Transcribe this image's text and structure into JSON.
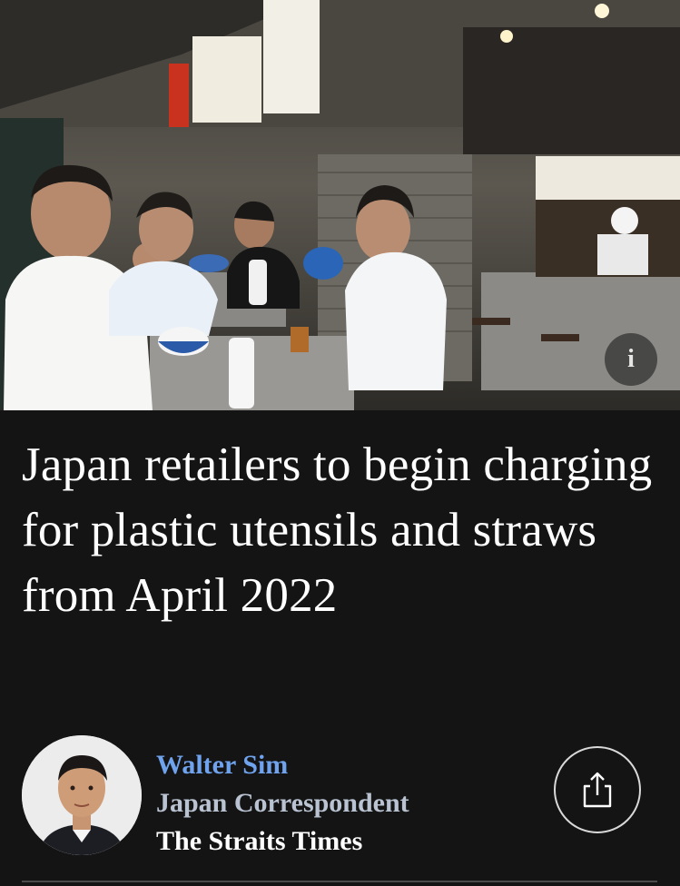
{
  "article": {
    "headline": "Japan retailers to begin charging for plastic utensils and straws from April 2022",
    "image_alt": "Diners eating standing at a noodle stall",
    "info_label": "i"
  },
  "author": {
    "name": "Walter Sim",
    "title": "Japan Correspondent",
    "publication": "The Straits Times"
  },
  "icons": {
    "info": "info-icon",
    "share": "share-icon"
  },
  "colors": {
    "background": "#141414",
    "author_name": "#6fa3ee",
    "author_title": "#b9c3d1"
  }
}
